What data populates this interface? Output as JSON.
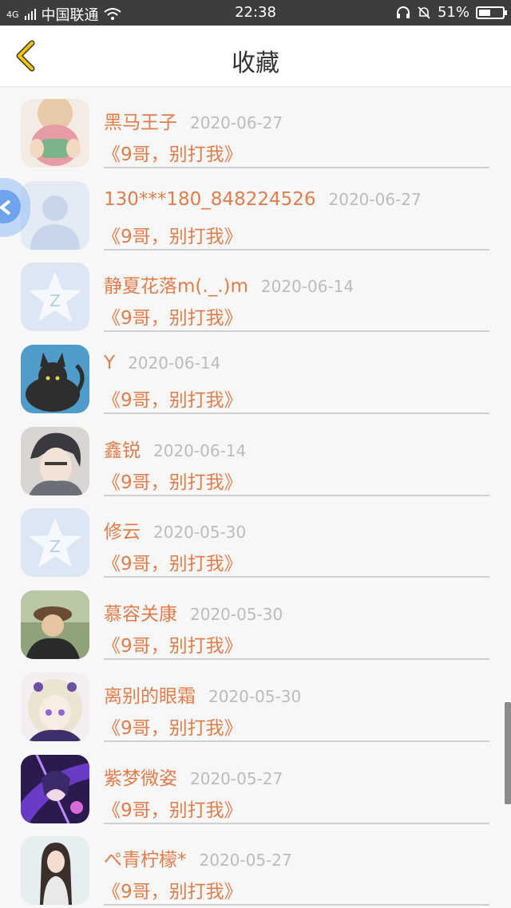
{
  "status_bar": {
    "network": "4G",
    "carrier": "中国联通",
    "time": "22:38",
    "battery": "51%",
    "battery_level": 0.51
  },
  "header": {
    "title": "收藏",
    "back_icon": "chevron-left-icon"
  },
  "colors": {
    "accent": "#e07d4a",
    "back_arrow": "#f5c400",
    "date": "#bcbcbc"
  },
  "items": [
    {
      "name": "黑马王子",
      "date": "2020-06-27",
      "book": "《9哥，别打我》"
    },
    {
      "name": "130***180_848224526",
      "date": "2020-06-27",
      "book": "《9哥，别打我》"
    },
    {
      "name": "静夏花落m(._.)m",
      "date": "2020-06-14",
      "book": "《9哥，别打我》"
    },
    {
      "name": "Y",
      "date": "2020-06-14",
      "book": "《9哥，别打我》"
    },
    {
      "name": "鑫锐",
      "date": "2020-06-14",
      "book": "《9哥，别打我》"
    },
    {
      "name": "修云",
      "date": "2020-05-30",
      "book": "《9哥，别打我》"
    },
    {
      "name": "慕容关康",
      "date": "2020-05-30",
      "book": "《9哥，别打我》"
    },
    {
      "name": "离别的眼霜",
      "date": "2020-05-30",
      "book": "《9哥，别打我》"
    },
    {
      "name": "紫梦微姿",
      "date": "2020-05-27",
      "book": "《9哥，别打我》"
    },
    {
      "name": "ぺ青柠檬*",
      "date": "2020-05-27",
      "book": "《9哥，别打我》"
    }
  ]
}
